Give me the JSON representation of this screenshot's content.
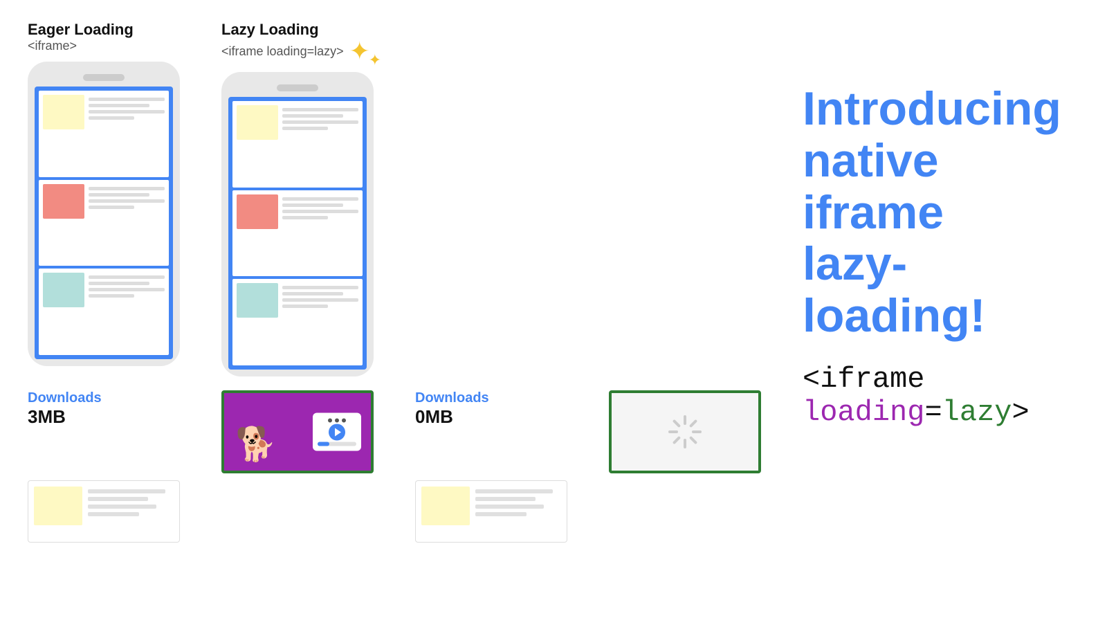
{
  "left": {
    "eager": {
      "title": "Eager Loading",
      "subtitle": "<iframe>",
      "downloads_label": "Downloads",
      "downloads_size": "3MB"
    },
    "lazy": {
      "title": "Lazy Loading",
      "subtitle": "<iframe loading=lazy>",
      "downloads_label": "Downloads",
      "downloads_size": "0MB"
    }
  },
  "right": {
    "introducing": "Introducing\nnative iframe\nlazy-loading!",
    "code_prefix": "<iframe ",
    "code_loading": "loading",
    "code_equals": "=",
    "code_lazy": "lazy",
    "code_suffix": ">"
  }
}
